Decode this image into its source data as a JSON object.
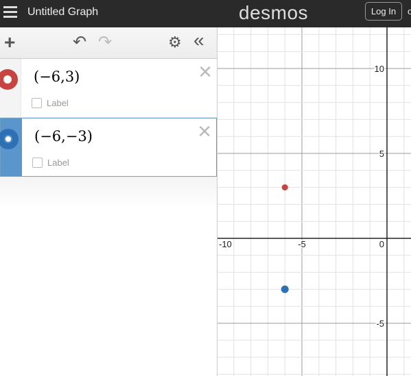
{
  "header": {
    "title": "Untitled Graph",
    "logo": "desmos",
    "login_label": "Log In",
    "trailing_text": "or"
  },
  "toolbar": {
    "add": "+",
    "undo": "↶",
    "redo": "↷",
    "settings": "⚙",
    "collapse": "«"
  },
  "expressions": [
    {
      "latex": "(−6,3)",
      "color": "#c74440",
      "label": "Label",
      "selected": false
    },
    {
      "latex": "(−6,−3)",
      "color": "#2d70b3",
      "label": "Label",
      "selected": true
    }
  ],
  "graph": {
    "xrange": [
      -10,
      1
    ],
    "yrange": [
      -8,
      12
    ],
    "x_ticks": [
      {
        "v": -10,
        "t": "-10"
      },
      {
        "v": -5,
        "t": "-5"
      },
      {
        "v": 0,
        "t": "0"
      }
    ],
    "y_ticks": [
      {
        "v": 10,
        "t": "10"
      },
      {
        "v": 5,
        "t": "5"
      },
      {
        "v": -5,
        "t": "-5"
      }
    ],
    "points": [
      {
        "x": -6,
        "y": 3,
        "color": "#c74440"
      },
      {
        "x": -6,
        "y": -3,
        "color": "#2d70b3"
      }
    ]
  }
}
